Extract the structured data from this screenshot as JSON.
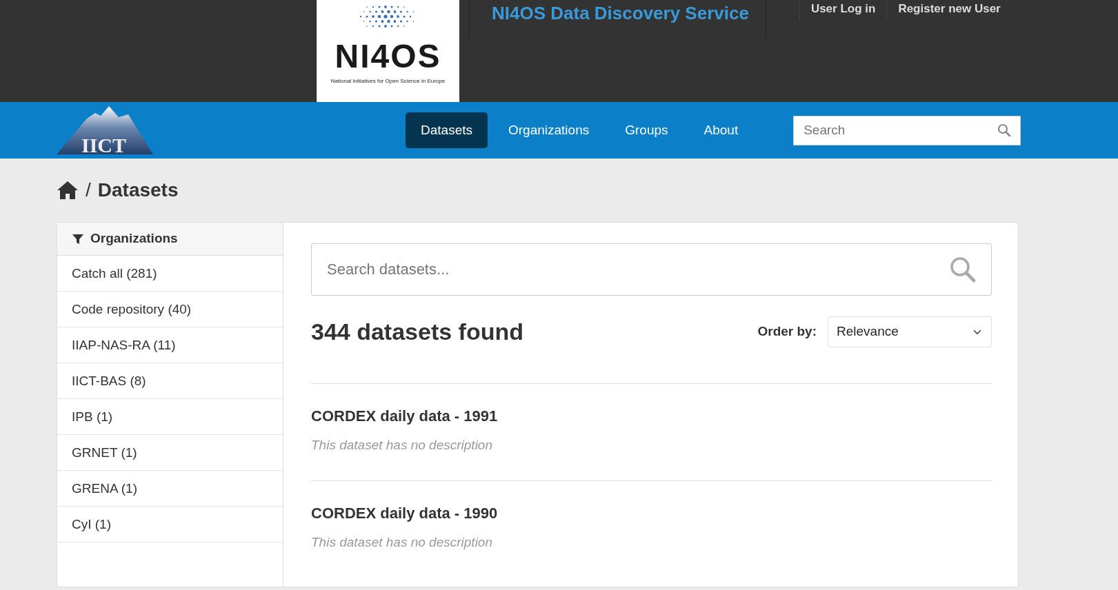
{
  "header": {
    "logo_text": "NI4OS",
    "logo_tagline": "National Initiatives for Open Science in Europe",
    "site_title": "NI4OS Data Discovery Service",
    "account_links": [
      "User Log in",
      "Register new User"
    ]
  },
  "navbar": {
    "logo_text": "IICT",
    "tabs": [
      {
        "label": "Datasets",
        "selected": true
      },
      {
        "label": "Organizations",
        "selected": false
      },
      {
        "label": "Groups",
        "selected": false
      },
      {
        "label": "About",
        "selected": false
      }
    ],
    "search": {
      "placeholder": "Search"
    }
  },
  "breadcrumb": {
    "separator": "/",
    "current": "Datasets"
  },
  "sidebar": {
    "heading": "Organizations",
    "items": [
      "Catch all (281)",
      "Code repository (40)",
      "IIAP-NAS-RA (11)",
      "IICT-BAS (8)",
      "IPB (1)",
      "GRNET (1)",
      "GRENA (1)",
      "CyI (1)"
    ]
  },
  "main": {
    "search": {
      "placeholder": "Search datasets..."
    },
    "result_count": "344 datasets found",
    "order_by": {
      "label": "Order by:",
      "value": "Relevance"
    },
    "datasets": [
      {
        "title": "CORDEX daily data - 1991",
        "description": "This dataset has no description"
      },
      {
        "title": "CORDEX daily data - 1990",
        "description": "This dataset has no description"
      }
    ]
  }
}
